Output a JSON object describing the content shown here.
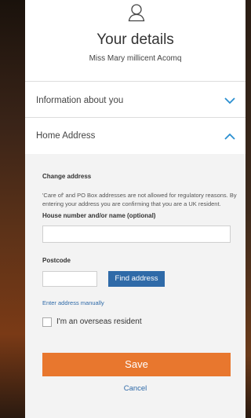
{
  "header": {
    "user_icon": "user-icon",
    "title": "Your details",
    "name": "Miss Mary millicent Acomq"
  },
  "sections": {
    "info_label": "Information about you",
    "info_icon": "chevron-down-icon",
    "home_label": "Home Address",
    "home_icon": "chevron-up-icon"
  },
  "address_form": {
    "change_title": "Change address",
    "notice": "'Care of' and PO Box addresses are not allowed for regulatory reasons. By entering your address you are confirming that you are a UK resident.",
    "house_label": "House number and/or name (optional)",
    "house_value": "",
    "postcode_label": "Postcode",
    "postcode_value": "",
    "find_button": "Find address",
    "manual_link": "Enter address manually",
    "overseas_label": "I'm an overseas resident",
    "overseas_checked": false
  },
  "actions": {
    "save": "Save",
    "cancel": "Cancel"
  },
  "colors": {
    "accent_blue": "#2f6aa8",
    "save_orange": "#e8772e",
    "chevron_blue": "#2a8fd0"
  }
}
